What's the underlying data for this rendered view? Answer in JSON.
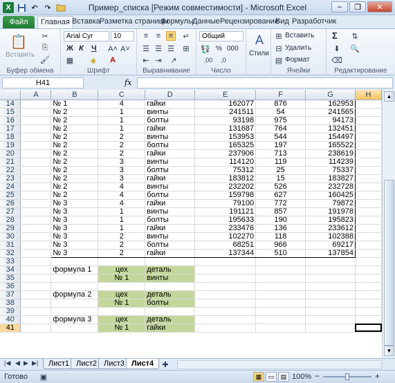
{
  "window": {
    "title": "Пример_списка  [Режим совместимости]  -  Microsoft Excel",
    "minimize": "–",
    "restore": "❐",
    "close": "✕"
  },
  "qat": {
    "excel_icon": "X",
    "save_icon": "save-icon",
    "undo_icon": "undo-icon",
    "redo_icon": "redo-icon",
    "open_icon": "folder-icon"
  },
  "ribbon_tabs": [
    "Файл",
    "Главная",
    "Вставка",
    "Разметка страницы",
    "Формулы",
    "Данные",
    "Рецензирование",
    "Вид",
    "Разработчик"
  ],
  "ribbon": {
    "clipboard": {
      "paste": "Вставить",
      "label": "Буфер обмена"
    },
    "font": {
      "name": "Arial Cyr",
      "size": "10",
      "bold": "Ж",
      "italic": "К",
      "underline": "Ч",
      "label": "Шрифт"
    },
    "alignment": {
      "label": "Выравнивание"
    },
    "number": {
      "format": "Общий",
      "percent": "%",
      "thousands": "000",
      "label": "Число"
    },
    "styles": {
      "label": "Стили"
    },
    "cells": {
      "insert": "Вставить",
      "delete": "Удалить",
      "format": "Формат",
      "label": "Ячейки"
    },
    "editing": {
      "label": "Редактирование",
      "sigma": "Σ"
    }
  },
  "formula_bar": {
    "name_box": "H41",
    "fx": "fx",
    "value": ""
  },
  "columns": [
    "A",
    "B",
    "C",
    "D",
    "E",
    "F",
    "G",
    "H"
  ],
  "rows": [
    {
      "n": "14",
      "b": "№ 1",
      "c": "4",
      "d": "гайки",
      "e": "162077",
      "f": "876",
      "g": "162953"
    },
    {
      "n": "15",
      "b": "№ 2",
      "c": "1",
      "d": "винты",
      "e": "241511",
      "f": "54",
      "g": "241565"
    },
    {
      "n": "16",
      "b": "№ 2",
      "c": "1",
      "d": "болты",
      "e": "93198",
      "f": "975",
      "g": "94173"
    },
    {
      "n": "17",
      "b": "№ 2",
      "c": "1",
      "d": "гайки",
      "e": "131687",
      "f": "764",
      "g": "132451"
    },
    {
      "n": "18",
      "b": "№ 2",
      "c": "2",
      "d": "винты",
      "e": "153953",
      "f": "544",
      "g": "154497"
    },
    {
      "n": "19",
      "b": "№ 2",
      "c": "2",
      "d": "болты",
      "e": "165325",
      "f": "197",
      "g": "165522"
    },
    {
      "n": "20",
      "b": "№ 2",
      "c": "2",
      "d": "гайки",
      "e": "237906",
      "f": "713",
      "g": "238619"
    },
    {
      "n": "21",
      "b": "№ 2",
      "c": "3",
      "d": "винты",
      "e": "114120",
      "f": "119",
      "g": "114239"
    },
    {
      "n": "22",
      "b": "№ 2",
      "c": "3",
      "d": "болты",
      "e": "75312",
      "f": "25",
      "g": "75337"
    },
    {
      "n": "23",
      "b": "№ 2",
      "c": "3",
      "d": "гайки",
      "e": "183812",
      "f": "15",
      "g": "183827"
    },
    {
      "n": "24",
      "b": "№ 2",
      "c": "4",
      "d": "винты",
      "e": "232202",
      "f": "526",
      "g": "232728"
    },
    {
      "n": "25",
      "b": "№ 2",
      "c": "4",
      "d": "болты",
      "e": "159798",
      "f": "627",
      "g": "160425"
    },
    {
      "n": "26",
      "b": "№ 3",
      "c": "4",
      "d": "гайки",
      "e": "79100",
      "f": "772",
      "g": "79872"
    },
    {
      "n": "27",
      "b": "№ 3",
      "c": "1",
      "d": "винты",
      "e": "191121",
      "f": "857",
      "g": "191978"
    },
    {
      "n": "28",
      "b": "№ 3",
      "c": "1",
      "d": "болты",
      "e": "195633",
      "f": "190",
      "g": "195823"
    },
    {
      "n": "29",
      "b": "№ 3",
      "c": "1",
      "d": "гайки",
      "e": "233476",
      "f": "136",
      "g": "233612"
    },
    {
      "n": "30",
      "b": "№ 3",
      "c": "2",
      "d": "винты",
      "e": "102270",
      "f": "118",
      "g": "102388"
    },
    {
      "n": "31",
      "b": "№ 3",
      "c": "2",
      "d": "болты",
      "e": "68251",
      "f": "966",
      "g": "69217"
    },
    {
      "n": "32",
      "b": "№ 3",
      "c": "2",
      "d": "гайки",
      "e": "137344",
      "f": "510",
      "g": "137854"
    },
    {
      "n": "33",
      "b": "",
      "c": "",
      "d": "",
      "e": "",
      "f": "",
      "g": ""
    },
    {
      "n": "34",
      "b": "формула 1",
      "c": "цех",
      "d": "деталь",
      "e": "",
      "f": "",
      "g": ""
    },
    {
      "n": "35",
      "b": "",
      "c": "№ 1",
      "d": "винты",
      "e": "",
      "f": "",
      "g": ""
    },
    {
      "n": "36",
      "b": "",
      "c": "",
      "d": "",
      "e": "",
      "f": "",
      "g": ""
    },
    {
      "n": "37",
      "b": "формула 2",
      "c": "цех",
      "d": "деталь",
      "e": "",
      "f": "",
      "g": ""
    },
    {
      "n": "38",
      "b": "",
      "c": "№ 1",
      "d": "болты",
      "e": "",
      "f": "",
      "g": ""
    },
    {
      "n": "39",
      "b": "",
      "c": "",
      "d": "",
      "e": "",
      "f": "",
      "g": ""
    },
    {
      "n": "40",
      "b": "формула 3",
      "c": "цех",
      "d": "деталь",
      "e": "",
      "f": "",
      "g": ""
    },
    {
      "n": "41",
      "b": "",
      "c": "№ 1",
      "d": "гайки",
      "e": "",
      "f": "",
      "g": ""
    }
  ],
  "sheet_tabs": [
    "Лист1",
    "Лист2",
    "Лист3",
    "Лист4"
  ],
  "active_sheet": "Лист4",
  "status": {
    "ready": "Готово",
    "zoom": "100%",
    "minus": "−",
    "plus": "+"
  }
}
